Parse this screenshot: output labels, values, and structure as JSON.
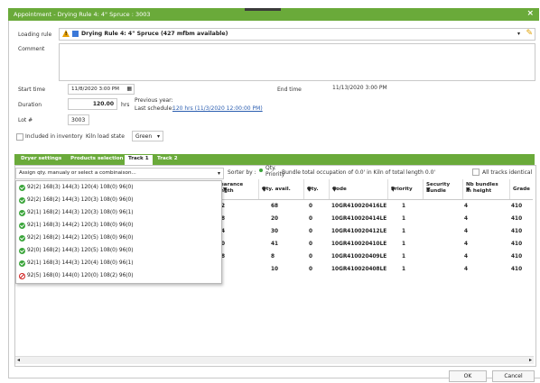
{
  "window": {
    "title": "Appointment - Drying Rule 4: 4\" Spruce : 3003",
    "close_icon": "×"
  },
  "loading_rule": {
    "label": "Loading rule",
    "value": "Drying Rule 4: 4\" Spruce (427 mfbm available)"
  },
  "comment": {
    "label": "Comment",
    "value": ""
  },
  "start_time": {
    "label": "Start time",
    "value": "11/8/2020 3:00 PM"
  },
  "end_time": {
    "label": "End time",
    "value": "11/13/2020 3:00 PM"
  },
  "duration": {
    "label": "Duration",
    "value": "120.00",
    "unit": "hrs",
    "previous_year": "Previous year:",
    "last_schedule_label": "Last schedule:",
    "last_schedule_link": "120 hrs (11/3/2020 12:00:00 PM)"
  },
  "lot": {
    "label": "Lot #",
    "value": "3003"
  },
  "inventory": {
    "label": "Included in inventory",
    "kiln_label": "Kiln load state",
    "kiln_value": "Green"
  },
  "tabs": [
    {
      "label": "Dryer settings"
    },
    {
      "label": "Products selection"
    },
    {
      "label": "Track 1"
    },
    {
      "label": "Track 2"
    }
  ],
  "assign": {
    "placeholder": "Assign qty. manualy or select a combinaison..."
  },
  "sorter": {
    "label": "Sorter by :",
    "option": "Qty. Priority",
    "bundle_text": "Bundle total occupation of 0.0' in Kiln of total length 0.0'",
    "all_tracks": "All tracks identical"
  },
  "combos": [
    {
      "text": "92(2) 168(3) 144(3) 120(4) 108(0) 96(0)",
      "ok": true
    },
    {
      "text": "92(2) 168(2) 144(3) 120(3) 108(0) 96(0)",
      "ok": true
    },
    {
      "text": "92(1) 168(2) 144(3) 120(3) 108(0) 96(1)",
      "ok": true
    },
    {
      "text": "92(1) 168(3) 144(2) 120(3) 108(0) 96(0)",
      "ok": true
    },
    {
      "text": "92(2) 168(2) 144(2) 120(5) 108(0) 96(0)",
      "ok": true
    },
    {
      "text": "92(0) 168(2) 144(3) 120(5) 108(0) 96(0)",
      "ok": true
    },
    {
      "text": "92(1) 168(3) 144(3) 120(4) 108(0) 96(1)",
      "ok": true
    },
    {
      "text": "92(5) 168(0) 144(0) 120(0) 108(2) 96(0)",
      "ok": false
    }
  ],
  "grid": {
    "columns": [
      "earance ngth",
      "Qty. avail.",
      "Qty.",
      "Code",
      "Priority",
      "Security Bundle",
      "Nb bundles in height",
      "Grade"
    ],
    "rows": [
      {
        "c0": "2",
        "avail": "68",
        "qty": "0",
        "code": "10GR410020416LE",
        "prio": "1",
        "sec": "4",
        "grade": "410"
      },
      {
        "c0": "8",
        "avail": "20",
        "qty": "0",
        "code": "10GR410020414LE",
        "prio": "1",
        "sec": "4",
        "grade": "410"
      },
      {
        "c0": "4",
        "avail": "30",
        "qty": "0",
        "code": "10GR410020412LE",
        "prio": "1",
        "sec": "4",
        "grade": "410"
      },
      {
        "c0": "0",
        "avail": "41",
        "qty": "0",
        "code": "10GR410020410LE",
        "prio": "1",
        "sec": "4",
        "grade": "410"
      },
      {
        "c0": "8",
        "avail": "8",
        "qty": "0",
        "code": "10GR410020409LE",
        "prio": "1",
        "sec": "4",
        "grade": "410"
      },
      {
        "c0": "",
        "avail": "10",
        "qty": "0",
        "code": "10GR410020408LE",
        "prio": "1",
        "sec": "4",
        "grade": "410"
      }
    ]
  },
  "buttons": {
    "ok": "OK",
    "cancel": "Cancel"
  }
}
